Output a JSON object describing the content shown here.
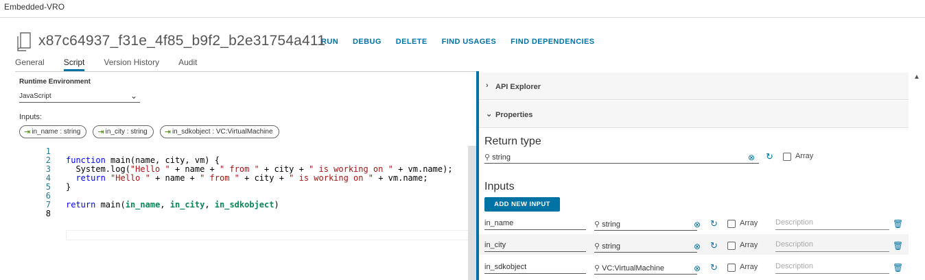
{
  "topbar": {
    "tab": "Embedded-VRO"
  },
  "header": {
    "title": "x87c64937_f31e_4f85_b9f2_b2e31754a411",
    "actions": [
      "RUN",
      "DEBUG",
      "DELETE",
      "FIND USAGES",
      "FIND DEPENDENCIES"
    ]
  },
  "tabs": [
    "General",
    "Script",
    "Version History",
    "Audit"
  ],
  "active_tab": "Script",
  "left": {
    "runtime_label": "Runtime Environment",
    "runtime_value": "JavaScript",
    "inputs_label": "Inputs:",
    "pills": [
      "in_name : string",
      "in_city : string",
      "in_sdkobject : VC:VirtualMachine"
    ]
  },
  "editor": {
    "line_numbers": [
      "1",
      "2",
      "3",
      "4",
      "5",
      "6",
      "7",
      "8"
    ]
  },
  "right": {
    "api_explorer": "API Explorer",
    "properties": "Properties",
    "return_type_label": "Return type",
    "return_type_value": "string",
    "array_label": "Array",
    "inputs_label": "Inputs",
    "add_input_label": "ADD NEW INPUT",
    "inputs": [
      {
        "name": "in_name",
        "type": "string",
        "description_placeholder": "Description"
      },
      {
        "name": "in_city",
        "type": "string",
        "description_placeholder": "Description"
      },
      {
        "name": "in_sdkobject",
        "type": "VC:VirtualMachine",
        "description_placeholder": "Description"
      }
    ]
  },
  "colors": {
    "accent": "#0072a3",
    "input_pin": "#3c8500"
  }
}
